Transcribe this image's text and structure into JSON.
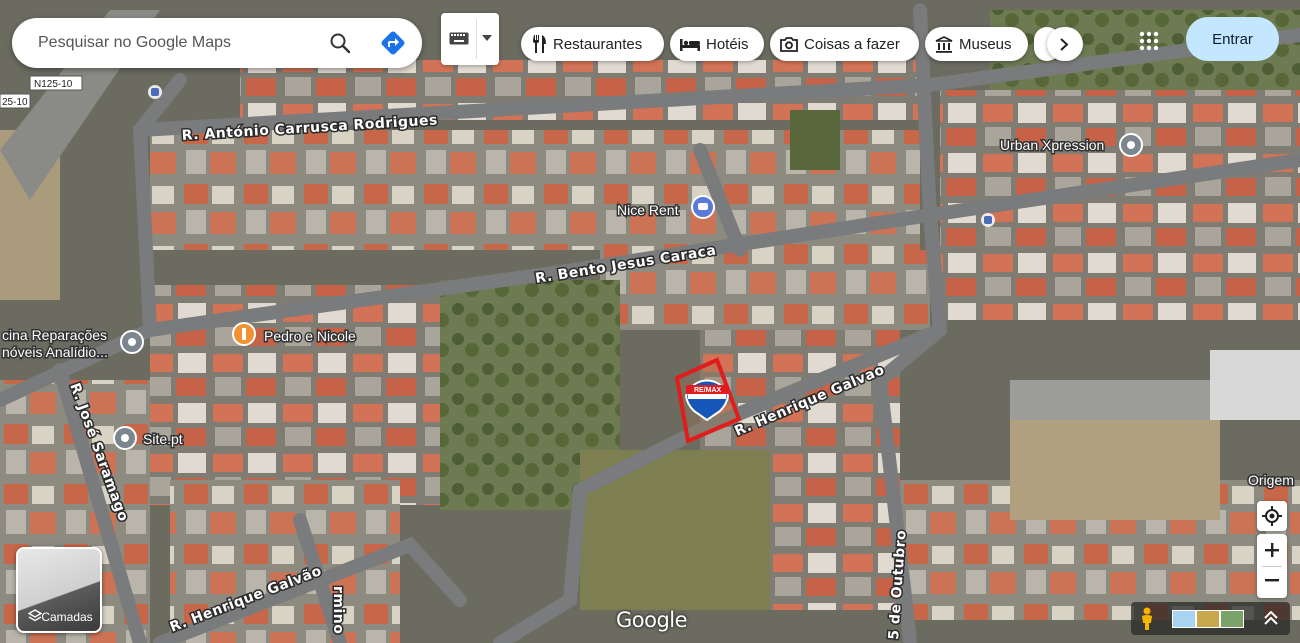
{
  "search": {
    "placeholder": "Pesquisar no Google Maps"
  },
  "chips": [
    {
      "label": "Restaurantes",
      "icon": "fork-knife-icon"
    },
    {
      "label": "Hotéis",
      "icon": "bed-icon"
    },
    {
      "label": "Coisas a fazer",
      "icon": "camera-icon"
    },
    {
      "label": "Museus",
      "icon": "museum-icon"
    }
  ],
  "signin_label": "Entrar",
  "layers_label": "Camadas",
  "attribution": "Google",
  "roads": {
    "r1": "R. António Carrusca Rodrigues",
    "r2": "R. Bento Jesus Caraca",
    "r3": "R. José Saramago",
    "r4": "R. Henrique Galvão",
    "r5": "R. Henrique Galvao",
    "r6": "5 de Outubro",
    "r7": "rmino",
    "hw1": "N125-10",
    "hw2": "25-10"
  },
  "pois": {
    "p1": "Urban Xpression",
    "p2": "Nice Rent",
    "p3": "Pedro e Nicole",
    "p4": "cina Reparações",
    "p5": "nóveis Analídio...",
    "p6": "Site.pt",
    "p7": "Origem"
  },
  "marker": {
    "brand": "RE/MAX"
  },
  "colors": {
    "accent": "#1a73e8",
    "highlight": "#e01c1c",
    "signin_bg": "#c2e7ff"
  }
}
